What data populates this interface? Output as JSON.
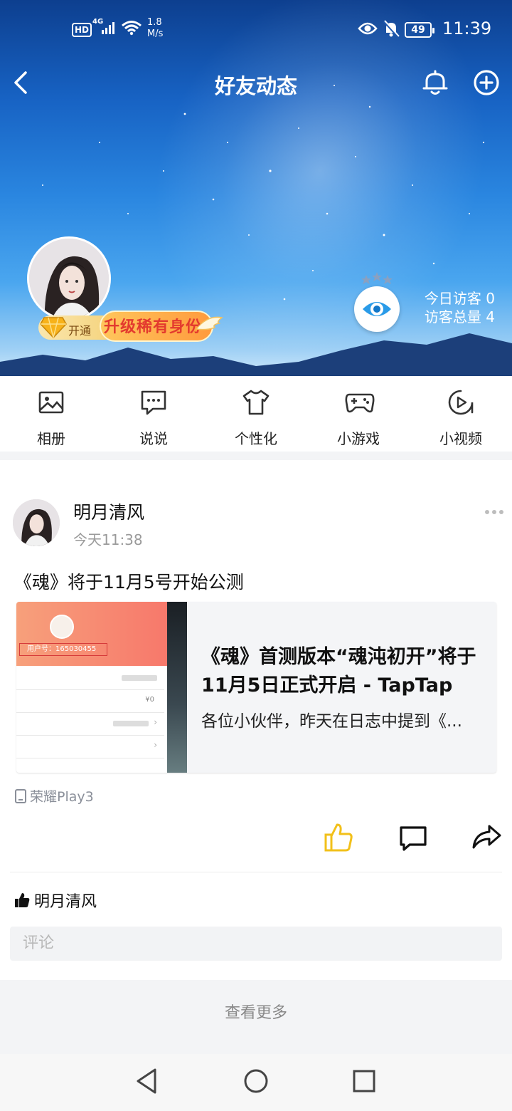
{
  "status_bar": {
    "hd": "HD",
    "network": "4G",
    "speed_value": "1.8",
    "speed_unit": "M/s",
    "battery": "49",
    "time": "11:39"
  },
  "topbar": {
    "title": "好友动态"
  },
  "profile": {
    "vip_open": "开通",
    "vip_upgrade": "升级稀有身份",
    "visitors_today": "今日访客 0",
    "visitors_total": "访客总量 4"
  },
  "menu": {
    "items": [
      {
        "label": "相册",
        "icon": "album-icon"
      },
      {
        "label": "说说",
        "icon": "talk-icon"
      },
      {
        "label": "个性化",
        "icon": "tshirt-icon"
      },
      {
        "label": "小游戏",
        "icon": "gamepad-icon"
      },
      {
        "label": "小视频",
        "icon": "video-icon"
      }
    ]
  },
  "post": {
    "author": "明月清风",
    "time": "今天11:38",
    "text": "《魂》将于11月5号开始公测",
    "card": {
      "title": "《魂》首测版本“魂沌初开”将于11月5日正式开启 - TapTap",
      "description": "各位小伙伴，昨天在日志中提到《...",
      "thumb_uid": "用户号：165030455",
      "thumb_value": "¥0"
    },
    "device": "荣耀Play3",
    "liked_by": "明月清风",
    "comment_placeholder": "评论"
  },
  "footer": {
    "view_more": "查看更多"
  },
  "colors": {
    "like_yellow": "#f2c01a",
    "badge_red": "#ee4a37",
    "eye_blue": "#2a9be8"
  }
}
